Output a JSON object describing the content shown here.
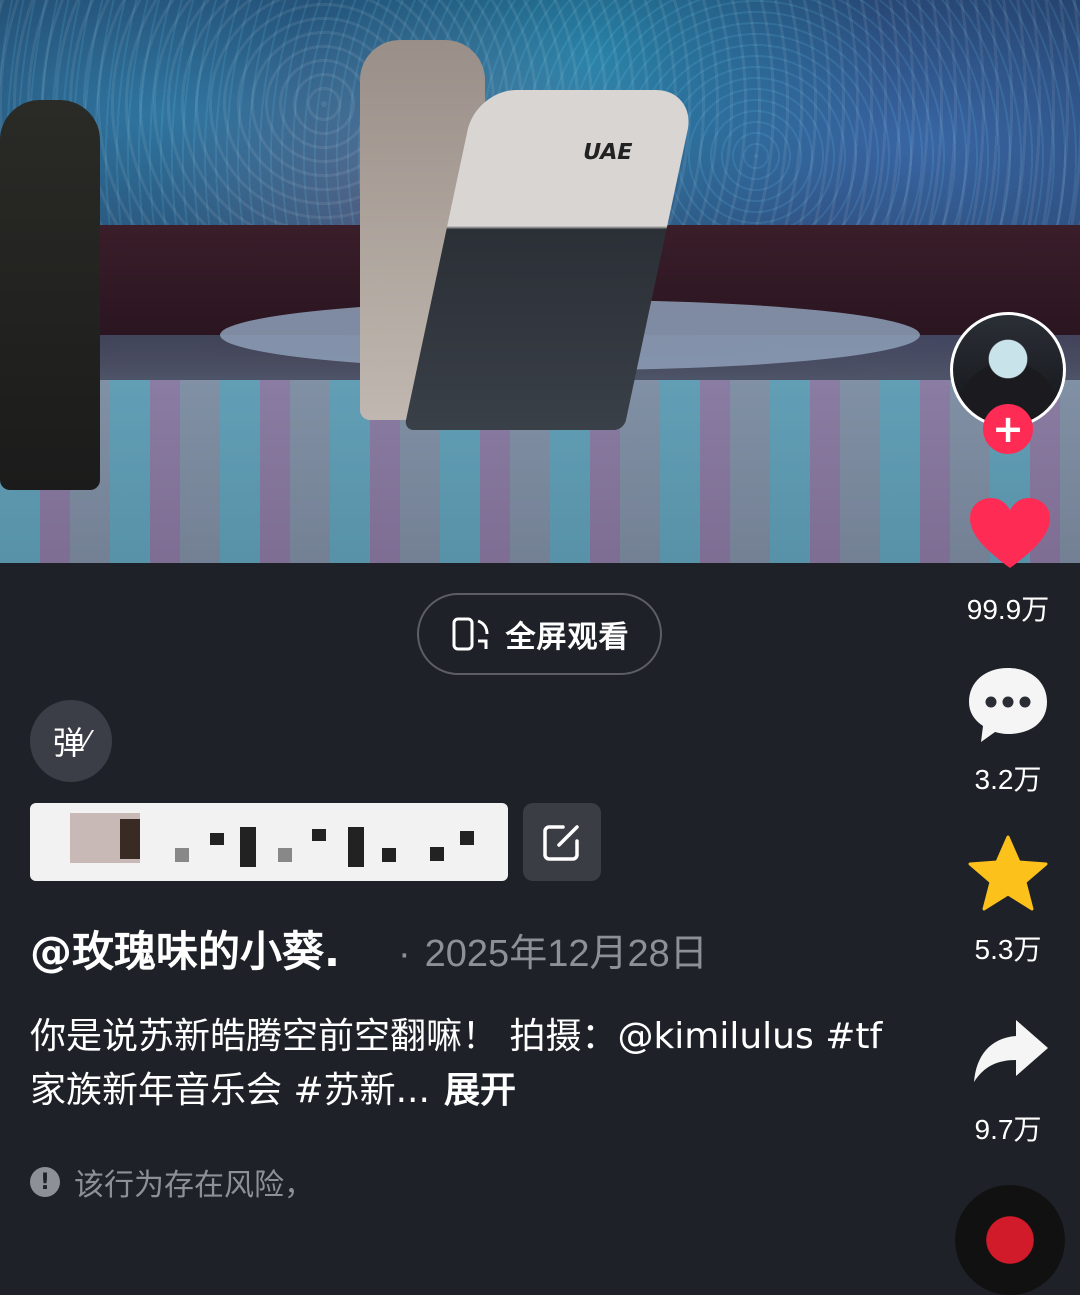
{
  "video": {
    "jersey_text": "UAE"
  },
  "fullscreen": {
    "label": "全屏观看"
  },
  "danmu": {
    "label": "弹"
  },
  "actions": {
    "likes": "99.9万",
    "comments": "3.2万",
    "favorites": "5.3万",
    "shares": "9.7万"
  },
  "colors": {
    "like": "#fe2c55",
    "favorite": "#fcc11a",
    "follow": "#fe2c55",
    "muted_text": "#8e9097"
  },
  "post": {
    "author": "@玫瑰味的小葵.",
    "separator": "·",
    "date": "2025年12月28日",
    "description": "你是说苏新皓腾空前空翻嘛！ 拍摄：@kimilulus #tf家族新年音乐会 #苏新...",
    "expand": "展开"
  },
  "risk": {
    "text": "该行为存在风险，",
    "icon": "info-icon"
  }
}
